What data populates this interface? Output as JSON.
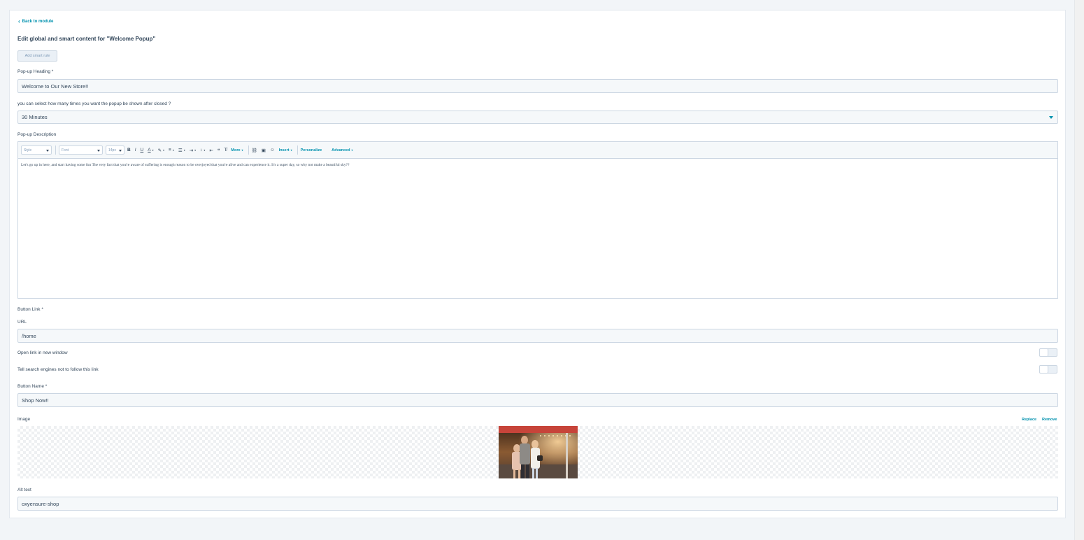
{
  "nav": {
    "back_label": "Back to module"
  },
  "page": {
    "title": "Edit global and smart content for \"Welcome Popup\""
  },
  "actions": {
    "add_smart_rule": "Add smart rule"
  },
  "fields": {
    "heading": {
      "label": "Pop-up Heading *",
      "value": "Welcome to Our New Store!!"
    },
    "frequency": {
      "label": "you can select how many times you want the popup be shown after closed ?",
      "value": "30 Minutes"
    },
    "description": {
      "label": "Pop-up Description",
      "text": "Let's go up in here, and start having some fun The very fact that you're aware of suffering is enough reason to be overjoyed that you're alive and can experience it. It's a super day, so why not make a beautiful sky??"
    },
    "button_link": {
      "label": "Button Link *",
      "url_label": "URL",
      "url_value": "/home"
    },
    "new_window": {
      "label": "Open link in new window",
      "enabled": false
    },
    "nofollow": {
      "label": "Tell search engines not to follow this link",
      "enabled": false
    },
    "button_name": {
      "label": "Button Name *",
      "value": "Shop Now!!"
    },
    "image": {
      "label": "Image",
      "replace": "Replace",
      "remove": "Remove"
    },
    "alt_text": {
      "label": "Alt text",
      "value": "oxyensure-shop"
    }
  },
  "toolbar": {
    "style": "Style",
    "font": "Font",
    "size": "14px",
    "bold": "B",
    "italic": "I",
    "underline": "U",
    "more": "More",
    "insert": "Insert",
    "personalize": "Personalize",
    "advanced": "Advanced"
  },
  "colors": {
    "accent": "#0091ae",
    "text": "#33475b",
    "border": "#cbd6e2",
    "input_bg": "#f5f8fa"
  }
}
